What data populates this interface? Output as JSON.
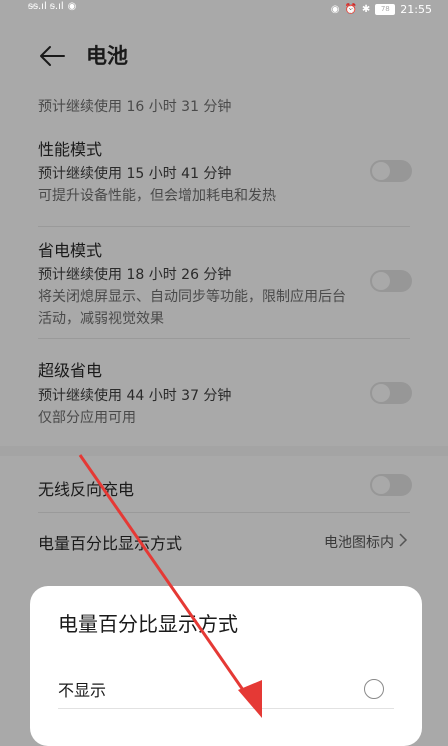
{
  "status_bar": {
    "signal_text": "ᵴᵴ.ıl ᵴ.ıl",
    "battery": "78",
    "time": "21:55"
  },
  "header": {
    "title": "电池"
  },
  "estimate": "预计继续使用 16 小时 31 分钟",
  "modes": [
    {
      "title": "性能模式",
      "subtitle": "预计继续使用 15 小时 41 分钟",
      "desc": "可提升设备性能，但会增加耗电和发热"
    },
    {
      "title": "省电模式",
      "subtitle": "预计继续使用 18 小时 26 分钟",
      "desc": "将关闭熄屏显示、自动同步等功能，限制应用后台活动，减弱视觉效果"
    },
    {
      "title": "超级省电",
      "subtitle": "预计继续使用 44 小时 37 分钟",
      "desc": "仅部分应用可用"
    }
  ],
  "wireless": {
    "label": "无线反向充电"
  },
  "percent_display": {
    "label": "电量百分比显示方式",
    "value": "电池图标内"
  },
  "dialog": {
    "title": "电量百分比显示方式",
    "options": [
      {
        "label": "不显示"
      }
    ]
  },
  "colors": {
    "annotation_arrow": "#e53935"
  }
}
